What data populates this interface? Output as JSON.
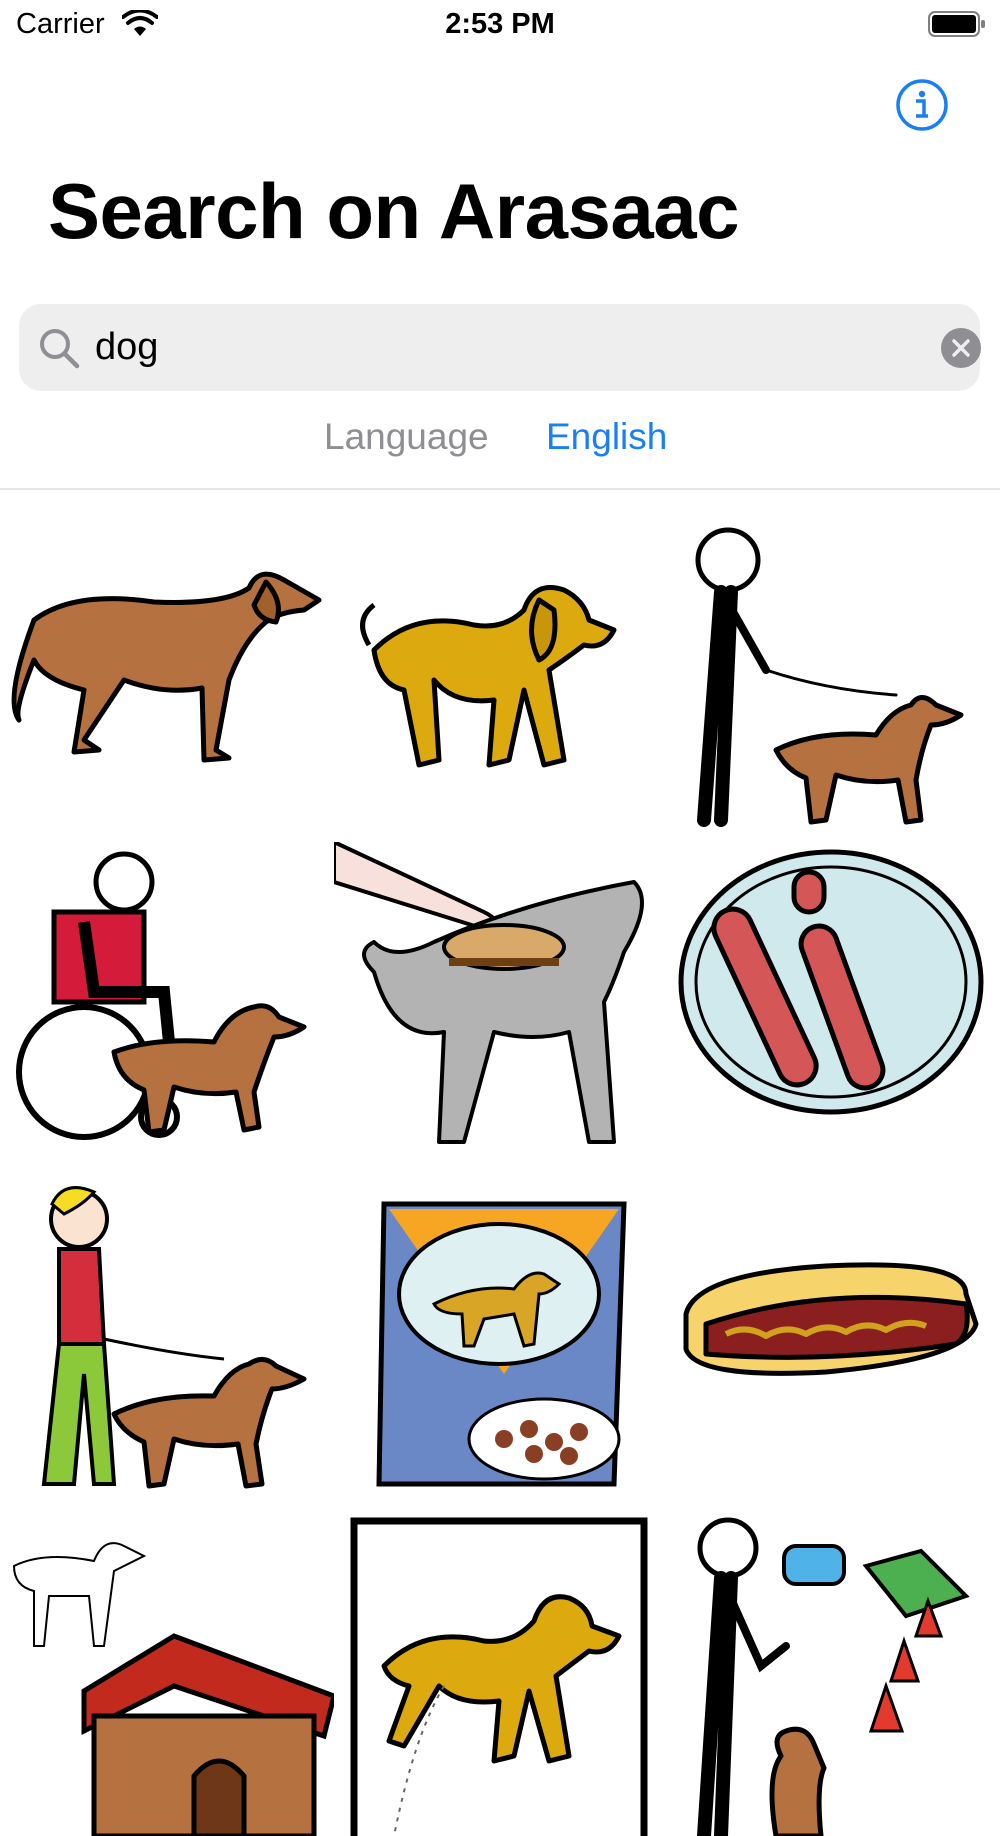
{
  "status_bar": {
    "carrier": "Carrier",
    "time": "2:53 PM",
    "wifi_icon": "wifi-icon",
    "battery_icon": "battery-icon"
  },
  "header": {
    "title": "Search on Arasaac",
    "info_icon": "info-circle-icon"
  },
  "search": {
    "value": "dog",
    "icon": "search-icon",
    "clear_icon": "clear-circle-icon"
  },
  "language": {
    "label": "Language",
    "value": "English"
  },
  "colors": {
    "accent": "#1a7ff2",
    "secondary_text": "#8e8e93",
    "search_bg": "#eeeeef",
    "divider": "#e5e5ea"
  },
  "results": [
    "dog",
    "dog",
    "walking-the-dog",
    "wheelchair-with-assistance-dog",
    "brushing-dog",
    "sausages-on-plate",
    "woman-walking-dog",
    "dog-food-bag",
    "hot-dog",
    "dog-kennel",
    "dog-urinating",
    "dog-training"
  ]
}
